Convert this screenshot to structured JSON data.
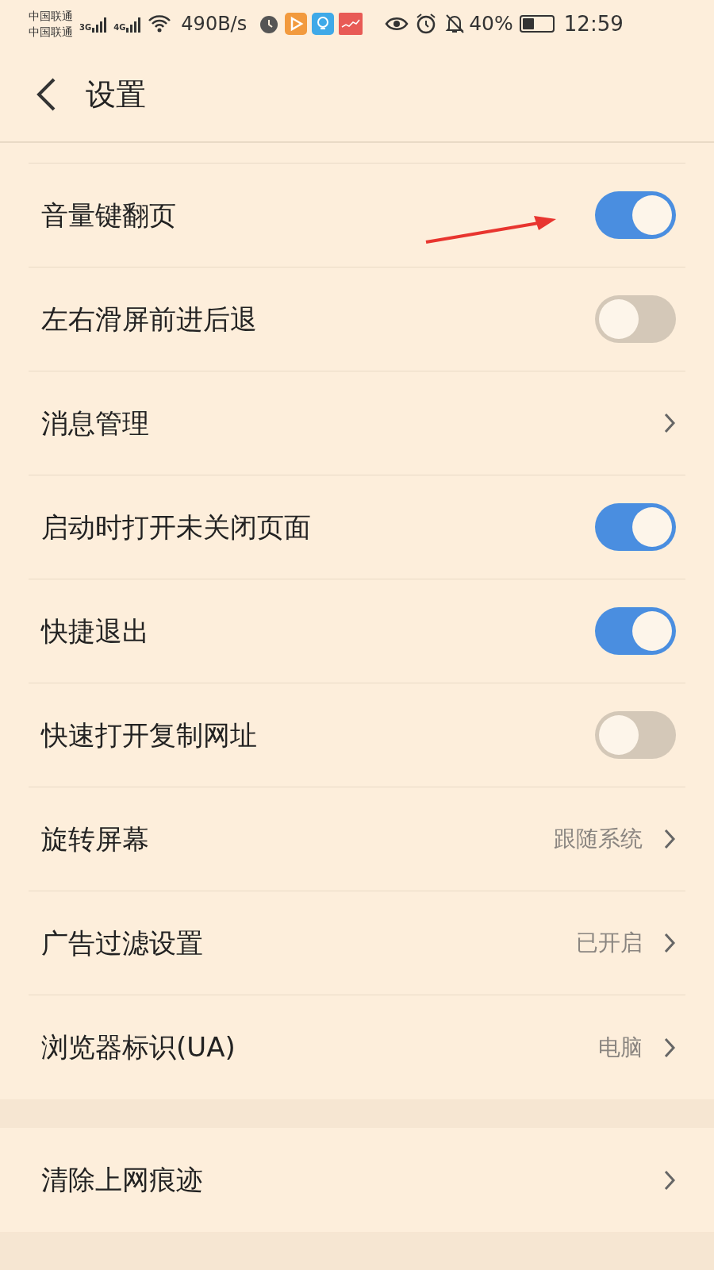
{
  "status_bar": {
    "carriers": [
      "中国联通",
      "中国联通"
    ],
    "networks": [
      "3G",
      "4G"
    ],
    "speed": "490B/s",
    "battery_text": "40%",
    "time": "12:59"
  },
  "header": {
    "title": "设置"
  },
  "groups": [
    {
      "items": [
        {
          "kind": "toggle",
          "label": "音量键翻页",
          "on": true
        },
        {
          "kind": "toggle",
          "label": "左右滑屏前进后退",
          "on": false
        },
        {
          "kind": "link",
          "label": "消息管理"
        },
        {
          "kind": "toggle",
          "label": "启动时打开未关闭页面",
          "on": true
        },
        {
          "kind": "toggle",
          "label": "快捷退出",
          "on": true
        },
        {
          "kind": "toggle",
          "label": "快速打开复制网址",
          "on": false
        },
        {
          "kind": "link",
          "label": "旋转屏幕",
          "value": "跟随系统"
        },
        {
          "kind": "link",
          "label": "广告过滤设置",
          "value": "已开启"
        },
        {
          "kind": "link",
          "label": "浏览器标识(UA)",
          "value": "电脑"
        }
      ]
    },
    {
      "items": [
        {
          "kind": "link",
          "label": "清除上网痕迹"
        }
      ]
    }
  ]
}
